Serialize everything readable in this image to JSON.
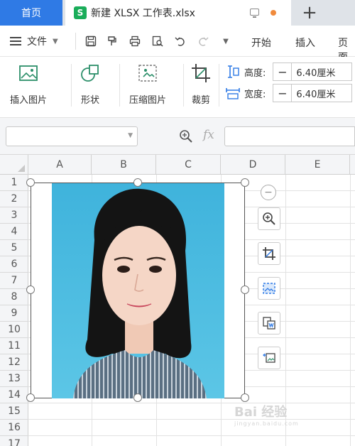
{
  "tabs": {
    "home": "首页",
    "doc_logo": "S",
    "doc": "新建 XLSX 工作表.xlsx",
    "add": "+"
  },
  "menu": {
    "file": "文件",
    "tabs": [
      "开始",
      "插入",
      "页面"
    ]
  },
  "ribbon": {
    "insert_picture": "插入图片",
    "shape": "形状",
    "compress": "压缩图片",
    "crop": "裁剪",
    "height_label": "高度:",
    "width_label": "宽度:",
    "height_value": "6.40厘米",
    "width_value": "6.40厘米"
  },
  "formula": {
    "fx": "fx",
    "name_value": "",
    "formula_value": ""
  },
  "grid": {
    "columns": [
      "A",
      "B",
      "C",
      "D",
      "E"
    ],
    "rows": [
      "1",
      "2",
      "3",
      "4",
      "5",
      "6",
      "7",
      "8",
      "9",
      "10",
      "11",
      "12",
      "13",
      "14",
      "15",
      "16",
      "17"
    ]
  },
  "watermark": {
    "text": "Bai 经验",
    "sub": "jingyan.baidu.com"
  },
  "colors": {
    "accent": "#2f7ae5",
    "photo_bg": "#4ab9de",
    "brand_green": "#1aad5a"
  }
}
